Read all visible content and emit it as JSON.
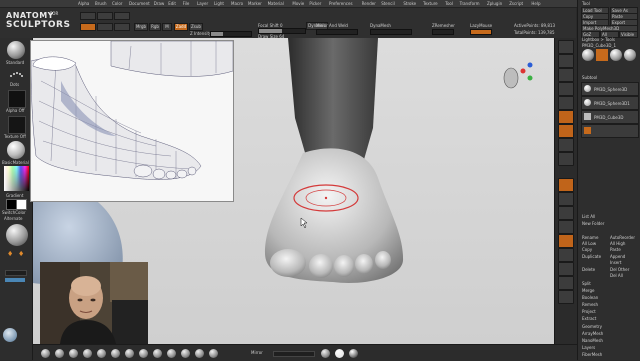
{
  "menu": [
    "Alpha",
    "Brush",
    "Color",
    "Document",
    "Draw",
    "Edit",
    "File",
    "Layer",
    "Light",
    "Macro",
    "Marker",
    "Material",
    "Movie",
    "Picker",
    "Preferences",
    "Render",
    "Stencil",
    "Stroke",
    "Texture",
    "Tool",
    "Transform",
    "Zplugin",
    "Zscript",
    "Help"
  ],
  "logo": {
    "line1": "ANATOMY",
    "small": "FOR",
    "line2": "SCULPTORS"
  },
  "top_shelf": {
    "focal_shift_label": "Focal Shift 0",
    "draw_size_label": "Draw Size 64",
    "rgb_intensity_label": "Z Intensity 30",
    "mrgb": "Mrgb",
    "rgb": "Rgb",
    "m": "M",
    "zadd": "Zadd",
    "zsub": "Zsub",
    "active_points": "ActivePoints: 89,813",
    "total_points": "TotalPoints: 139,785",
    "dynamic": "Dynamic",
    "mirror_weld": "Mirror And Weld",
    "dynamesh": "DynaMesh",
    "zremesher": "ZRemesher",
    "lazy_mouse": "LazyMouse",
    "backface": "BackfaceMask"
  },
  "left_shelf": {
    "brush_label": "Standard",
    "stroke_label": "Dots",
    "alpha_label": "Alpha Off",
    "texture_label": "Texture Off",
    "material_label": "BasicMaterial",
    "gradient_label": "Gradient",
    "switch_label": "SwitchColor",
    "alternate_label": "Alternate"
  },
  "right_tray": {
    "title": "Tool",
    "load_tool": "Load Tool",
    "save_as": "Save As",
    "copy": "Copy",
    "paste": "Paste",
    "import": "Import",
    "export": "Export",
    "clone": "Clone",
    "make_polymesh": "Make PolyMesh3D",
    "goz": "GoZ",
    "all": "All",
    "visible": "Visible",
    "lightbox_tools": "Lightbox > Tools",
    "current_tool": "PM3D_Cube3D_1",
    "subtool_title": "Subtool",
    "subtools": [
      "PM3D_Sphere3D",
      "PM3D_Sphere3D1",
      "PM3D_Cube3D"
    ],
    "list_all": "List All",
    "new_folder": "New Folder",
    "rename": "Rename",
    "auto_reorder": "AutoReorder",
    "all_low": "All Low",
    "all_high": "All High",
    "copy2": "Copy",
    "paste2": "Paste",
    "duplicate": "Duplicate",
    "append": "Append",
    "insert": "Insert",
    "delete": "Delete",
    "del_other": "Del Other",
    "del_all": "Del All",
    "split": "Split",
    "merge": "Merge",
    "boolean": "Boolean",
    "remesh": "Remesh",
    "project": "Project",
    "extract": "Extract",
    "geometry": "Geometry",
    "arraymesh": "ArrayMesh",
    "nanomesh": "NanoMesh",
    "layers": "Layers",
    "fibermesh": "FiberMesh"
  },
  "bottom_shelf": {
    "mirror_label": "Mirror"
  },
  "colors": {
    "accent": "#c66a1c",
    "stroke_ring": "#d43a3a",
    "viewport_bg": "#d6d6d6"
  }
}
